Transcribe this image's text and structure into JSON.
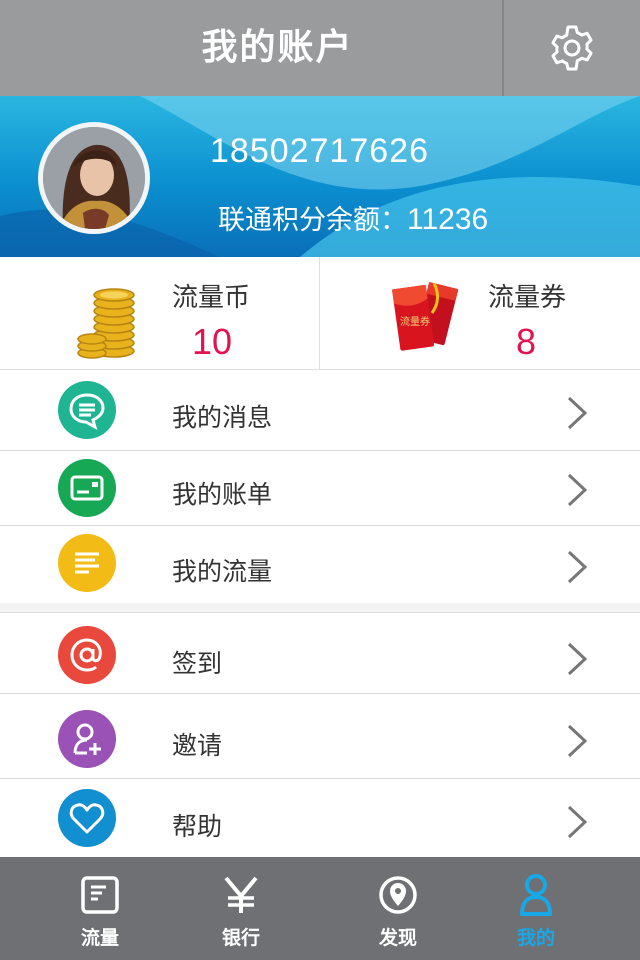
{
  "header": {
    "title": "我的账户",
    "settings_icon": "gear-icon"
  },
  "profile": {
    "phone": "18502717626",
    "points_label": "联通积分余额：",
    "points_value": "11236"
  },
  "stats": [
    {
      "label": "流量币",
      "value": "10",
      "icon": "gold-coins-icon"
    },
    {
      "label": "流量券",
      "value": "8",
      "icon": "red-envelope-coupon-icon",
      "icon_text": "流量券"
    }
  ],
  "menu": [
    {
      "label": "我的消息",
      "icon": "chat-bubble-icon",
      "color": "#1fb592"
    },
    {
      "label": "我的账单",
      "icon": "card-icon",
      "color": "#17a855"
    },
    {
      "label": "我的流量",
      "icon": "lines-icon",
      "color": "#f2bb16"
    },
    {
      "label": "签到",
      "icon": "at-sign-icon",
      "color": "#e9483d"
    },
    {
      "label": "邀请",
      "icon": "add-person-icon",
      "color": "#9a52b6"
    },
    {
      "label": "帮助",
      "icon": "heart-icon",
      "color": "#118fd0"
    }
  ],
  "tabs": [
    {
      "label": "流量",
      "icon": "document-icon"
    },
    {
      "label": "银行",
      "icon": "yen-icon"
    },
    {
      "label": "发现",
      "icon": "location-pin-icon"
    },
    {
      "label": "我的",
      "icon": "person-icon",
      "active": true
    }
  ],
  "colors": {
    "header_bg": "#9a9b9c",
    "banner_blue": "#0b8fd0",
    "stat_value": "#e2134f",
    "tabbar_bg": "#6e7073",
    "tab_active": "#18a8e8"
  }
}
